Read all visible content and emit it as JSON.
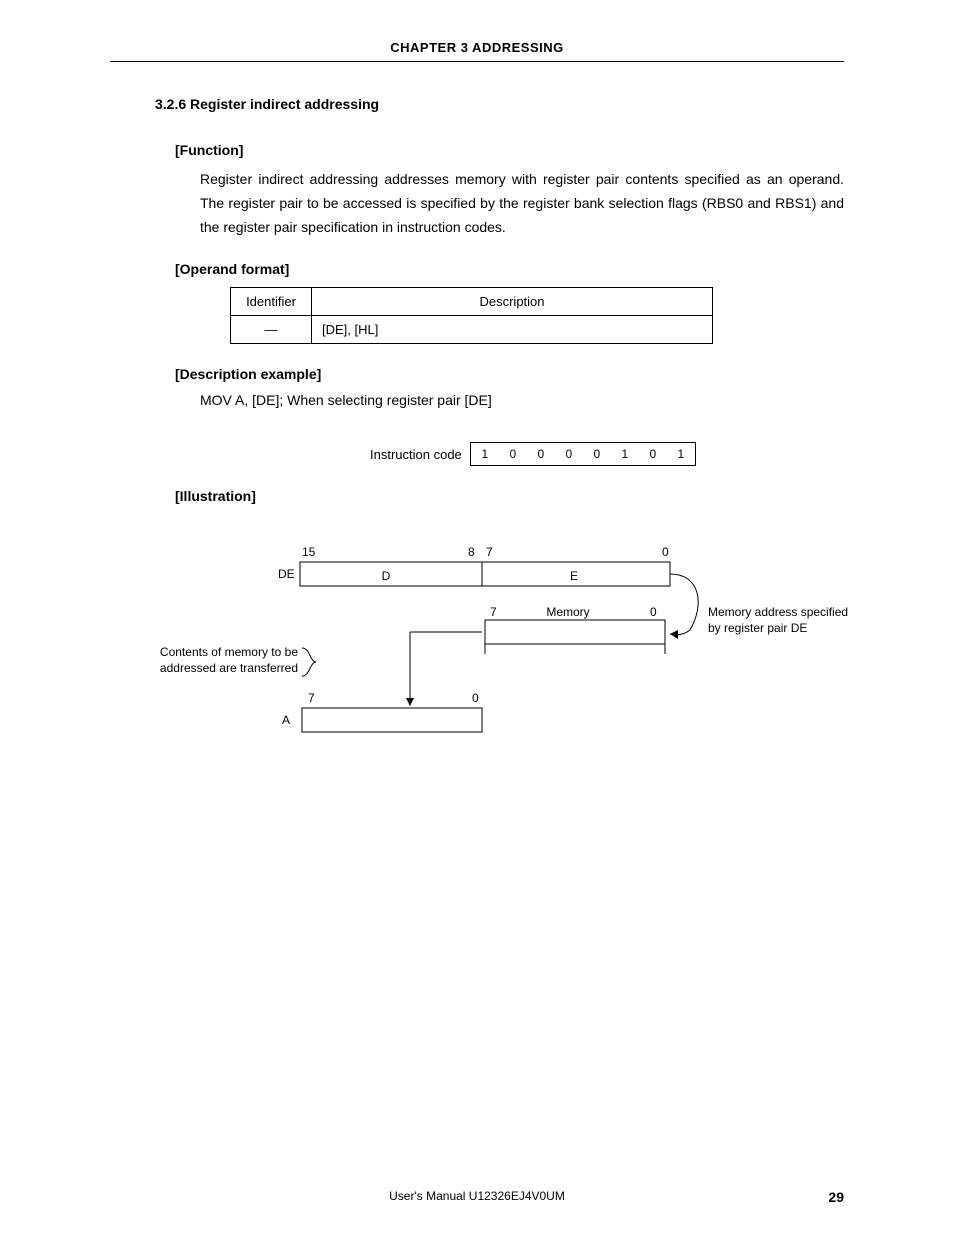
{
  "header": {
    "chapter": "CHAPTER 3  ADDRESSING"
  },
  "section": {
    "number_title": "3.2.6  Register indirect addressing",
    "function_head": "[Function]",
    "function_body": "Register indirect addressing addresses memory with register pair contents specified as an operand. The register pair to be accessed is specified by the register bank selection flags (RBS0 and RBS1) and the register pair specification in instruction codes.",
    "operand_head": "[Operand format]",
    "operand_table": {
      "col1": "Identifier",
      "col2": "Description",
      "row_id": "—",
      "row_desc": "[DE], [HL]"
    },
    "desc_example_head": "[Description example]",
    "desc_example_text": "MOV A, [DE]; When selecting register pair [DE]",
    "instr_label": "Instruction code",
    "bits": [
      "1",
      "0",
      "0",
      "0",
      "0",
      "1",
      "0",
      "1"
    ],
    "illustration_head": "[Illustration]"
  },
  "illus": {
    "n15": "15",
    "n8": "8",
    "n7a": "7",
    "n0a": "0",
    "de": "DE",
    "d": "D",
    "e": "E",
    "n7b": "7",
    "memory": "Memory",
    "n0b": "0",
    "note_right1": "Memory address specified",
    "note_right2": "by register pair DE",
    "note_left1": "Contents of memory to be",
    "note_left2": "addressed are transferred",
    "n7c": "7",
    "n0c": "0",
    "a": "A"
  },
  "footer": {
    "center": "User's Manual  U12326EJ4V0UM",
    "page": "29"
  }
}
